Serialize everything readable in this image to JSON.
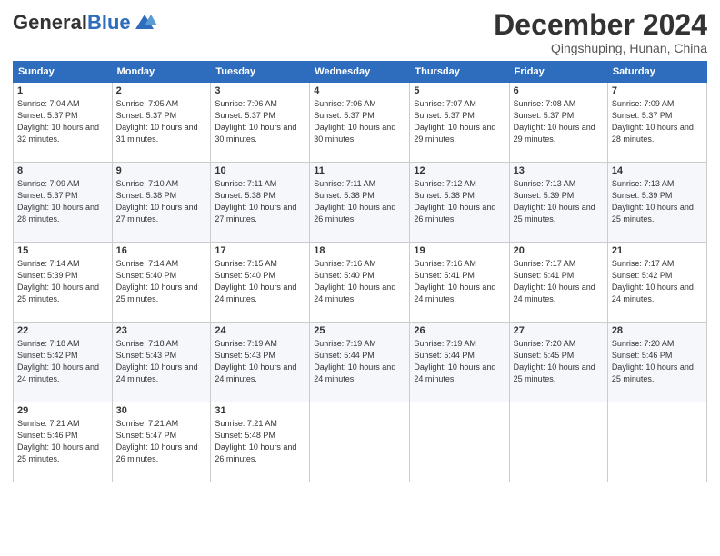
{
  "header": {
    "logo_general": "General",
    "logo_blue": "Blue",
    "month_title": "December 2024",
    "location": "Qingshuping, Hunan, China"
  },
  "days_of_week": [
    "Sunday",
    "Monday",
    "Tuesday",
    "Wednesday",
    "Thursday",
    "Friday",
    "Saturday"
  ],
  "weeks": [
    [
      {
        "day": "1",
        "sunrise": "7:04 AM",
        "sunset": "5:37 PM",
        "daylight": "10 hours and 32 minutes."
      },
      {
        "day": "2",
        "sunrise": "7:05 AM",
        "sunset": "5:37 PM",
        "daylight": "10 hours and 31 minutes."
      },
      {
        "day": "3",
        "sunrise": "7:06 AM",
        "sunset": "5:37 PM",
        "daylight": "10 hours and 30 minutes."
      },
      {
        "day": "4",
        "sunrise": "7:06 AM",
        "sunset": "5:37 PM",
        "daylight": "10 hours and 30 minutes."
      },
      {
        "day": "5",
        "sunrise": "7:07 AM",
        "sunset": "5:37 PM",
        "daylight": "10 hours and 29 minutes."
      },
      {
        "day": "6",
        "sunrise": "7:08 AM",
        "sunset": "5:37 PM",
        "daylight": "10 hours and 29 minutes."
      },
      {
        "day": "7",
        "sunrise": "7:09 AM",
        "sunset": "5:37 PM",
        "daylight": "10 hours and 28 minutes."
      }
    ],
    [
      {
        "day": "8",
        "sunrise": "7:09 AM",
        "sunset": "5:37 PM",
        "daylight": "10 hours and 28 minutes."
      },
      {
        "day": "9",
        "sunrise": "7:10 AM",
        "sunset": "5:38 PM",
        "daylight": "10 hours and 27 minutes."
      },
      {
        "day": "10",
        "sunrise": "7:11 AM",
        "sunset": "5:38 PM",
        "daylight": "10 hours and 27 minutes."
      },
      {
        "day": "11",
        "sunrise": "7:11 AM",
        "sunset": "5:38 PM",
        "daylight": "10 hours and 26 minutes."
      },
      {
        "day": "12",
        "sunrise": "7:12 AM",
        "sunset": "5:38 PM",
        "daylight": "10 hours and 26 minutes."
      },
      {
        "day": "13",
        "sunrise": "7:13 AM",
        "sunset": "5:39 PM",
        "daylight": "10 hours and 25 minutes."
      },
      {
        "day": "14",
        "sunrise": "7:13 AM",
        "sunset": "5:39 PM",
        "daylight": "10 hours and 25 minutes."
      }
    ],
    [
      {
        "day": "15",
        "sunrise": "7:14 AM",
        "sunset": "5:39 PM",
        "daylight": "10 hours and 25 minutes."
      },
      {
        "day": "16",
        "sunrise": "7:14 AM",
        "sunset": "5:40 PM",
        "daylight": "10 hours and 25 minutes."
      },
      {
        "day": "17",
        "sunrise": "7:15 AM",
        "sunset": "5:40 PM",
        "daylight": "10 hours and 24 minutes."
      },
      {
        "day": "18",
        "sunrise": "7:16 AM",
        "sunset": "5:40 PM",
        "daylight": "10 hours and 24 minutes."
      },
      {
        "day": "19",
        "sunrise": "7:16 AM",
        "sunset": "5:41 PM",
        "daylight": "10 hours and 24 minutes."
      },
      {
        "day": "20",
        "sunrise": "7:17 AM",
        "sunset": "5:41 PM",
        "daylight": "10 hours and 24 minutes."
      },
      {
        "day": "21",
        "sunrise": "7:17 AM",
        "sunset": "5:42 PM",
        "daylight": "10 hours and 24 minutes."
      }
    ],
    [
      {
        "day": "22",
        "sunrise": "7:18 AM",
        "sunset": "5:42 PM",
        "daylight": "10 hours and 24 minutes."
      },
      {
        "day": "23",
        "sunrise": "7:18 AM",
        "sunset": "5:43 PM",
        "daylight": "10 hours and 24 minutes."
      },
      {
        "day": "24",
        "sunrise": "7:19 AM",
        "sunset": "5:43 PM",
        "daylight": "10 hours and 24 minutes."
      },
      {
        "day": "25",
        "sunrise": "7:19 AM",
        "sunset": "5:44 PM",
        "daylight": "10 hours and 24 minutes."
      },
      {
        "day": "26",
        "sunrise": "7:19 AM",
        "sunset": "5:44 PM",
        "daylight": "10 hours and 24 minutes."
      },
      {
        "day": "27",
        "sunrise": "7:20 AM",
        "sunset": "5:45 PM",
        "daylight": "10 hours and 25 minutes."
      },
      {
        "day": "28",
        "sunrise": "7:20 AM",
        "sunset": "5:46 PM",
        "daylight": "10 hours and 25 minutes."
      }
    ],
    [
      {
        "day": "29",
        "sunrise": "7:21 AM",
        "sunset": "5:46 PM",
        "daylight": "10 hours and 25 minutes."
      },
      {
        "day": "30",
        "sunrise": "7:21 AM",
        "sunset": "5:47 PM",
        "daylight": "10 hours and 26 minutes."
      },
      {
        "day": "31",
        "sunrise": "7:21 AM",
        "sunset": "5:48 PM",
        "daylight": "10 hours and 26 minutes."
      },
      null,
      null,
      null,
      null
    ]
  ]
}
